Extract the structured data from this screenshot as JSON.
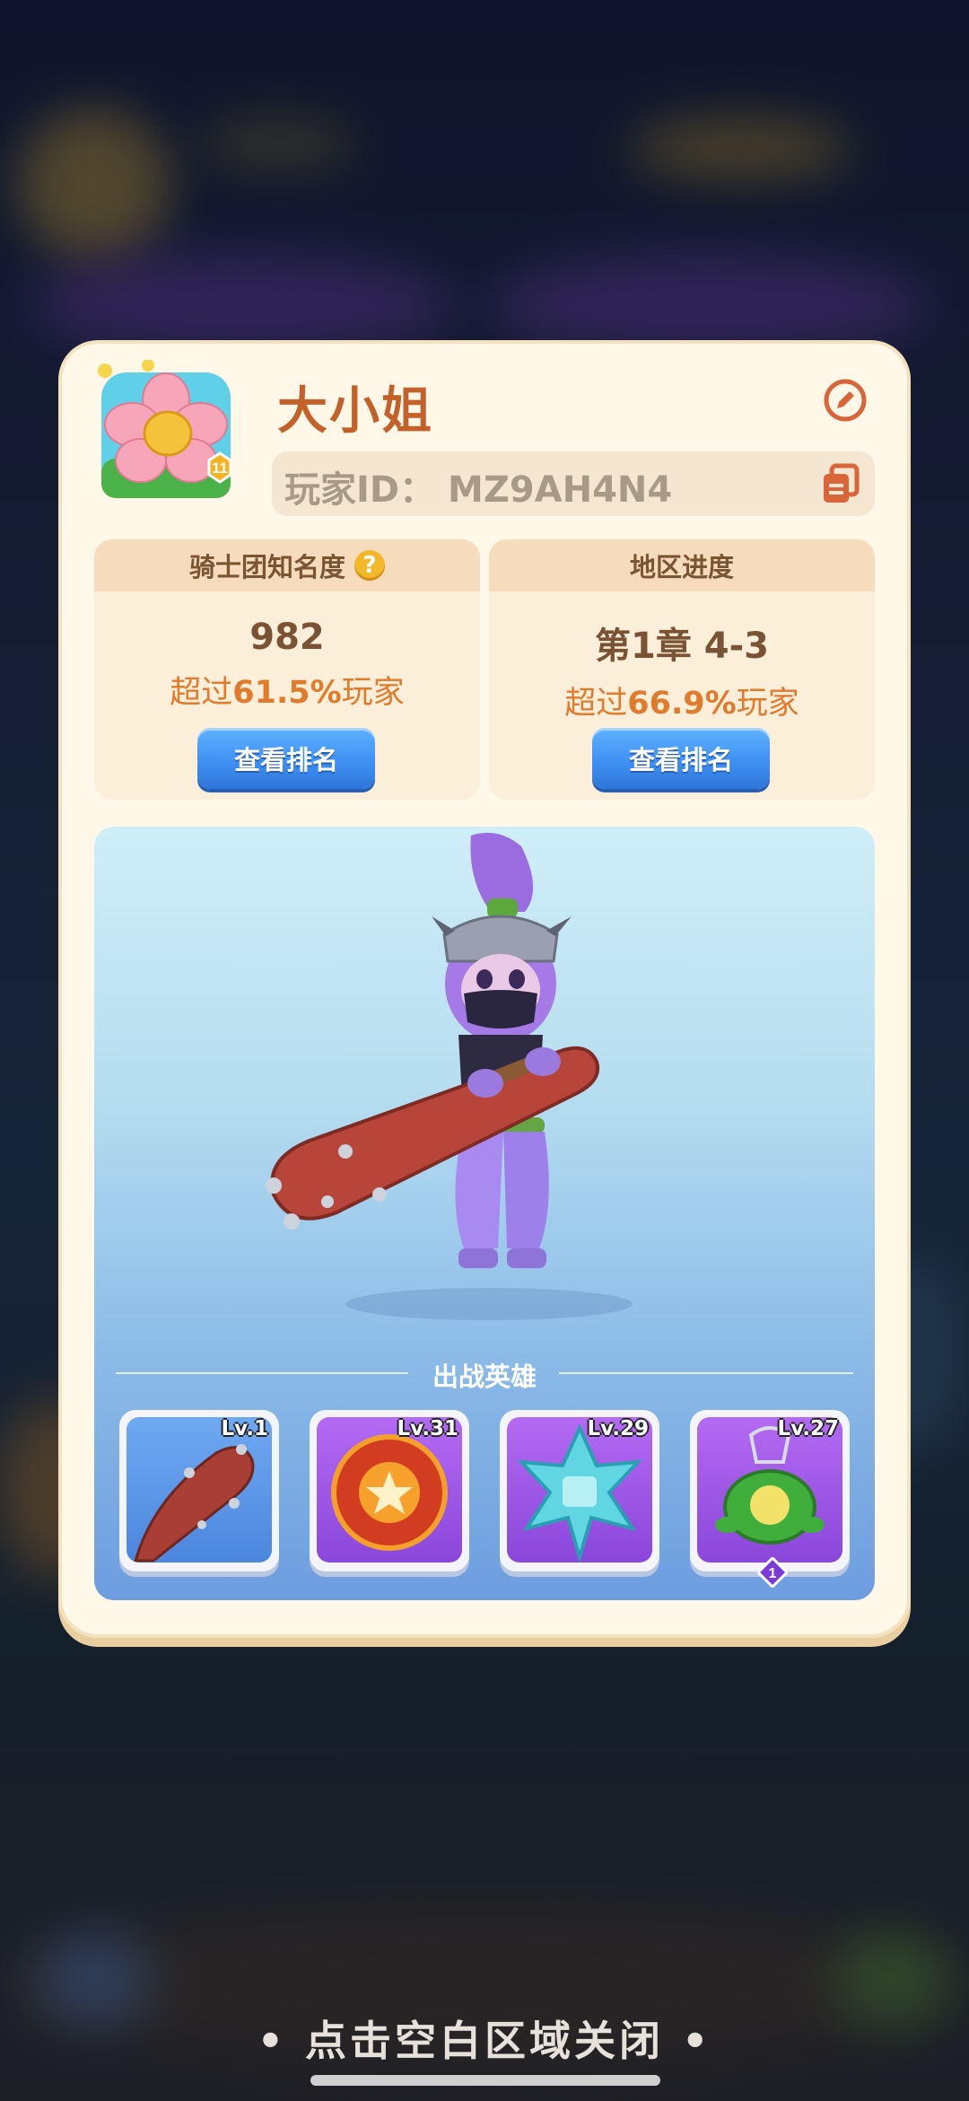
{
  "profile": {
    "name": "大小姐",
    "player_id": "玩家ID：  MZ9AH4N4",
    "avatar_level": "11"
  },
  "stats": [
    {
      "title": "骑士团知名度",
      "value": "982",
      "sub_prefix": "超过",
      "sub_percent": "61.5%",
      "sub_suffix": "玩家",
      "button": "查看排名"
    },
    {
      "title": "地区进度",
      "value": "第1章 4-3",
      "sub_prefix": "超过",
      "sub_percent": "66.9%",
      "sub_suffix": "玩家",
      "button": "查看排名"
    }
  ],
  "heroes": {
    "title": "出战英雄",
    "items": [
      {
        "icon": "spiked-club-icon",
        "level": "Lv.1"
      },
      {
        "icon": "fire-gear-orb-icon",
        "level": "Lv.31"
      },
      {
        "icon": "ice-star-icon",
        "level": "Lv.29"
      },
      {
        "icon": "turtle-pendant-icon",
        "level": "Lv.27",
        "badge": "1"
      }
    ]
  },
  "footer": {
    "close_hint": "• 点击空白区域关闭 •"
  },
  "colors": {
    "name": "#c2622a",
    "highlight": "#e07a2d",
    "button": "#3d8ef2",
    "card": "#fff8e9"
  }
}
